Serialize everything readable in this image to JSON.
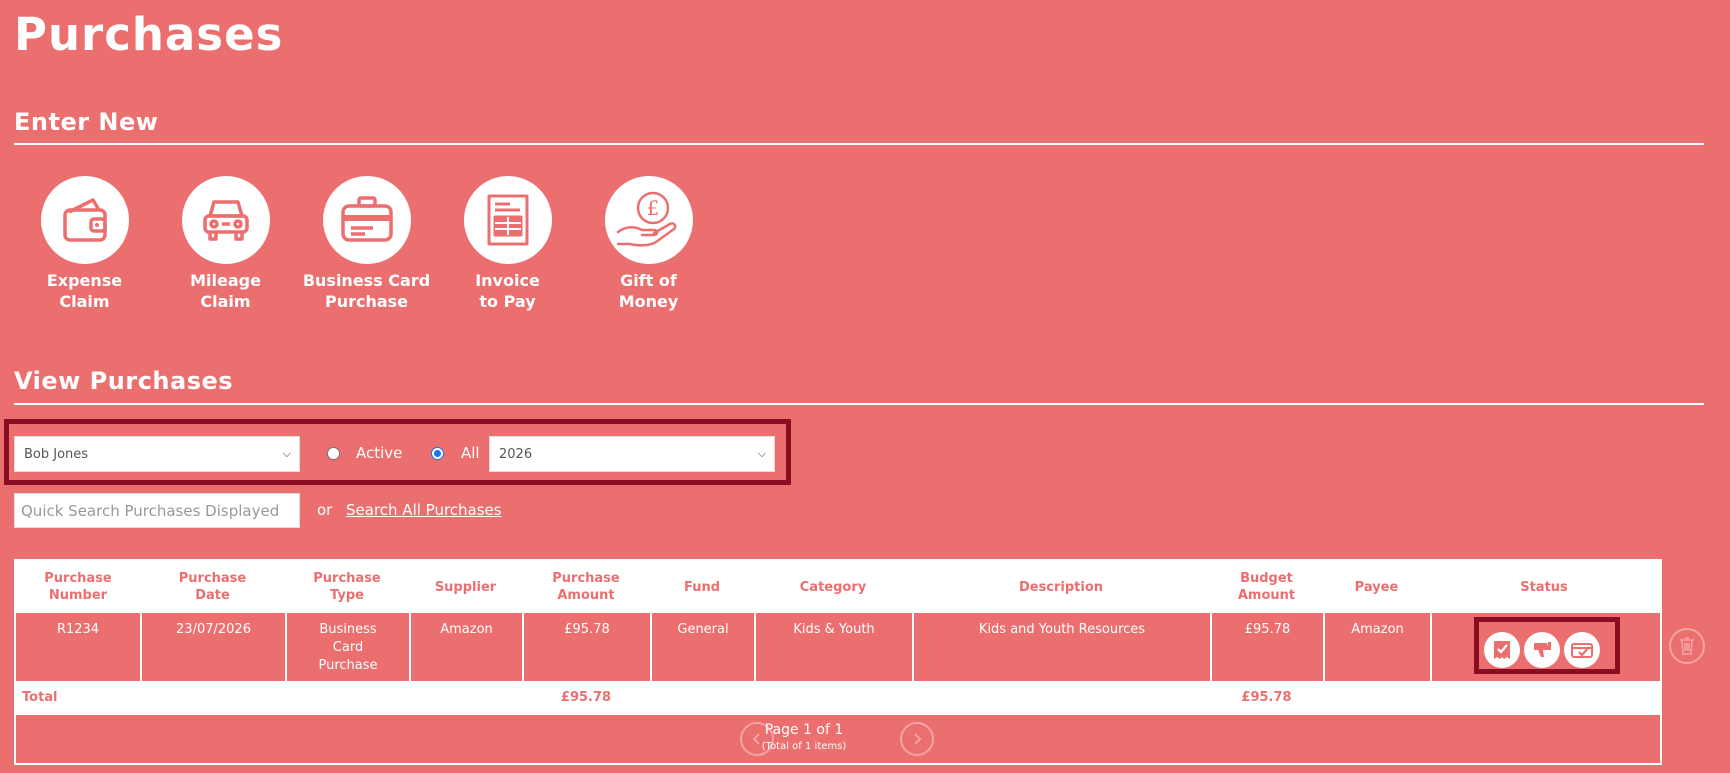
{
  "page": {
    "title": "Purchases"
  },
  "sections": {
    "enter_new": "Enter New",
    "view_purchases": "View Purchases"
  },
  "tiles": [
    {
      "label_line1": "Expense",
      "label_line2": "Claim",
      "icon": "wallet-icon"
    },
    {
      "label_line1": "Mileage",
      "label_line2": "Claim",
      "icon": "car-icon"
    },
    {
      "label_line1": "Business Card",
      "label_line2": "Purchase",
      "icon": "business-card-icon"
    },
    {
      "label_line1": "Invoice",
      "label_line2": "to Pay",
      "icon": "invoice-icon"
    },
    {
      "label_line1": "Gift of",
      "label_line2": "Money",
      "icon": "gift-money-icon"
    }
  ],
  "filters": {
    "person_select": "Bob Jones",
    "radio_active": "Active",
    "radio_all": "All",
    "selected_radio": "All",
    "year_select": "2026"
  },
  "search": {
    "placeholder": "Quick Search Purchases Displayed",
    "or_text": "or",
    "search_all_link": "Search All Purchases"
  },
  "table": {
    "headers": {
      "purchase_number": [
        "Purchase",
        "Number"
      ],
      "purchase_date": [
        "Purchase",
        "Date"
      ],
      "purchase_type": [
        "Purchase",
        "Type"
      ],
      "supplier": "Supplier",
      "purchase_amount": [
        "Purchase",
        "Amount"
      ],
      "fund": "Fund",
      "category": "Category",
      "description": "Description",
      "budget_amount": [
        "Budget",
        "Amount"
      ],
      "payee": "Payee",
      "status": "Status"
    },
    "rows": [
      {
        "purchase_number": "R1234",
        "purchase_date": "23/07/2026",
        "purchase_type": [
          "Business",
          "Card",
          "Purchase"
        ],
        "supplier": "Amazon",
        "purchase_amount": "£95.78",
        "fund": "General",
        "category": "Kids & Youth",
        "description": "Kids and Youth Resources",
        "budget_amount": "£95.78",
        "payee": "Amazon",
        "status_icons": [
          "receipt-approved-icon",
          "thumbs-down-flag-icon",
          "card-approved-icon"
        ]
      }
    ],
    "total": {
      "label": "Total",
      "purchase_amount": "£95.78",
      "budget_amount": "£95.78"
    },
    "pagination": {
      "page_text": "Page 1 of 1",
      "total_text": "(Total of 1 items)"
    }
  },
  "colors": {
    "background": "#ec6f70",
    "highlight_border": "#8b0d23",
    "radio_accent": "#1a73e8"
  }
}
